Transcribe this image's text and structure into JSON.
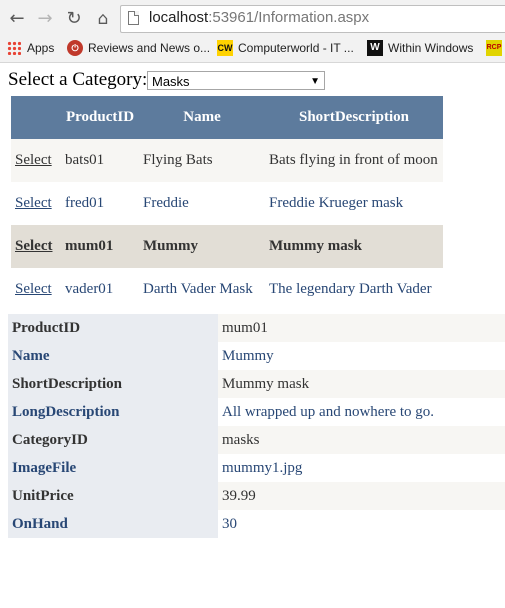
{
  "browser": {
    "url_host": "localhost",
    "url_rest": ":53961/Information.aspx",
    "bookmarks": [
      {
        "label": "Apps"
      },
      {
        "label": "Reviews and News o..."
      },
      {
        "label": "Computerworld - IT ..."
      },
      {
        "label": "Within Windows"
      }
    ],
    "icons": {
      "back": "back-arrow-icon",
      "forward": "forward-arrow-icon",
      "reload": "reload-icon",
      "home": "home-icon",
      "page": "page-icon"
    }
  },
  "category": {
    "label": "Select a Category:",
    "selected": "Masks"
  },
  "grid": {
    "columns": [
      "ProductID",
      "Name",
      "ShortDescription"
    ],
    "select_label": "Select",
    "rows": [
      {
        "id": "bats01",
        "name": "Flying Bats",
        "desc": "Bats flying in front of moon"
      },
      {
        "id": "fred01",
        "name": "Freddie",
        "desc": "Freddie Krueger mask"
      },
      {
        "id": "mum01",
        "name": "Mummy",
        "desc": "Mummy mask"
      },
      {
        "id": "vader01",
        "name": "Darth Vader Mask",
        "desc": "The legendary Darth Vader"
      }
    ]
  },
  "details": {
    "fields": [
      {
        "label": "ProductID",
        "value": "mum01"
      },
      {
        "label": "Name",
        "value": "Mummy"
      },
      {
        "label": "ShortDescription",
        "value": "Mummy mask"
      },
      {
        "label": "LongDescription",
        "value": "All wrapped up and nowhere to go."
      },
      {
        "label": "CategoryID",
        "value": "masks"
      },
      {
        "label": "ImageFile",
        "value": "mummy1.jpg"
      },
      {
        "label": "UnitPrice",
        "value": "39.99"
      },
      {
        "label": "OnHand",
        "value": "30"
      }
    ]
  },
  "colors": {
    "header_bg": "#5d7b9d",
    "alt_row_bg": "#f7f6f3",
    "selected_row_bg": "#e2ded6",
    "link_text": "#284775",
    "detail_header_bg": "#e9ecf1"
  }
}
